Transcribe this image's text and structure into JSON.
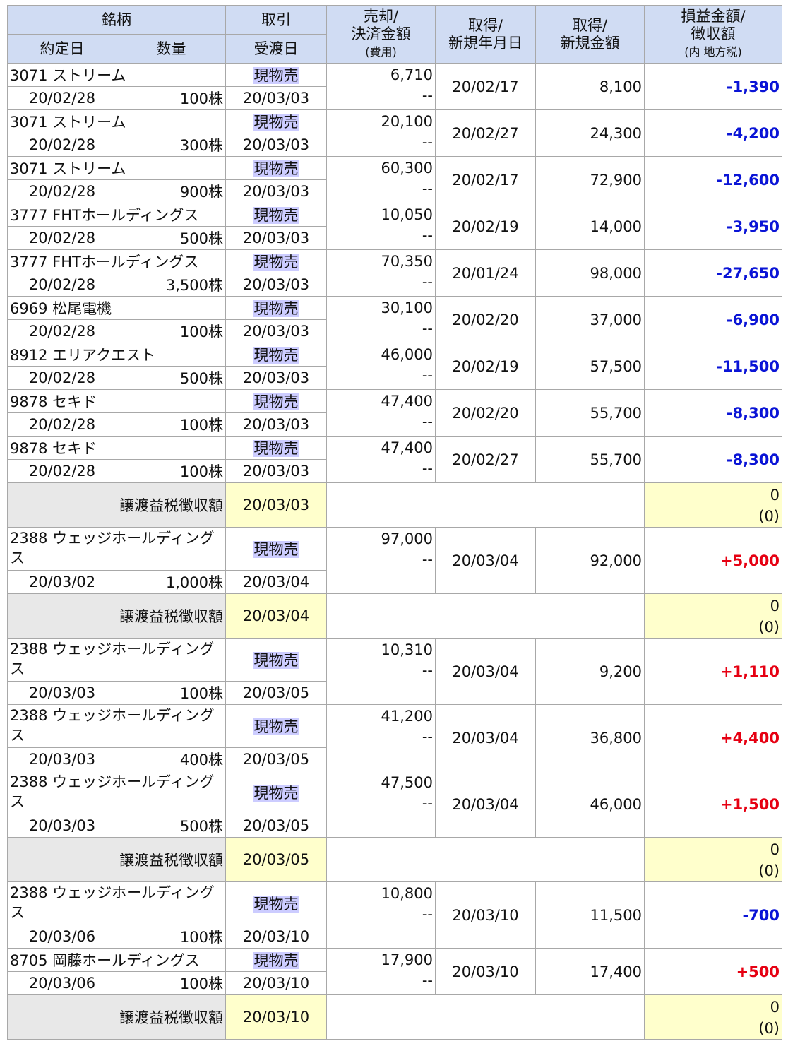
{
  "header": {
    "stock": "銘柄",
    "trade_date": "約定日",
    "quantity": "数量",
    "trade": "取引",
    "settle_date": "受渡日",
    "sale_amount_1": "売却/",
    "sale_amount_2": "決済金額",
    "sale_amount_3": "(費用)",
    "acq_date_1": "取得/",
    "acq_date_2": "新規年月日",
    "acq_amount_1": "取得/",
    "acq_amount_2": "新規金額",
    "pl_1": "損益金額/",
    "pl_2": "徴収額",
    "pl_3": "(内 地方税)"
  },
  "tax_label": "譲渡益税徴収額",
  "rows": [
    {
      "name": "3071 ストリーム",
      "trade_date": "20/02/28",
      "qty": "100株",
      "type": "現物売",
      "settle": "20/03/03",
      "sale": "6,710",
      "fee": "--",
      "acq_date": "20/02/17",
      "acq_amount": "8,100",
      "pl": "-1,390"
    },
    {
      "name": "3071 ストリーム",
      "trade_date": "20/02/28",
      "qty": "300株",
      "type": "現物売",
      "settle": "20/03/03",
      "sale": "20,100",
      "fee": "--",
      "acq_date": "20/02/27",
      "acq_amount": "24,300",
      "pl": "-4,200"
    },
    {
      "name": "3071 ストリーム",
      "trade_date": "20/02/28",
      "qty": "900株",
      "type": "現物売",
      "settle": "20/03/03",
      "sale": "60,300",
      "fee": "--",
      "acq_date": "20/02/17",
      "acq_amount": "72,900",
      "pl": "-12,600"
    },
    {
      "name": "3777 FHTホールディングス",
      "trade_date": "20/02/28",
      "qty": "500株",
      "type": "現物売",
      "settle": "20/03/03",
      "sale": "10,050",
      "fee": "--",
      "acq_date": "20/02/19",
      "acq_amount": "14,000",
      "pl": "-3,950"
    },
    {
      "name": "3777 FHTホールディングス",
      "trade_date": "20/02/28",
      "qty": "3,500株",
      "type": "現物売",
      "settle": "20/03/03",
      "sale": "70,350",
      "fee": "--",
      "acq_date": "20/01/24",
      "acq_amount": "98,000",
      "pl": "-27,650"
    },
    {
      "name": "6969 松尾電機",
      "trade_date": "20/02/28",
      "qty": "100株",
      "type": "現物売",
      "settle": "20/03/03",
      "sale": "30,100",
      "fee": "--",
      "acq_date": "20/02/20",
      "acq_amount": "37,000",
      "pl": "-6,900"
    },
    {
      "name": "8912 エリアクエスト",
      "trade_date": "20/02/28",
      "qty": "500株",
      "type": "現物売",
      "settle": "20/03/03",
      "sale": "46,000",
      "fee": "--",
      "acq_date": "20/02/19",
      "acq_amount": "57,500",
      "pl": "-11,500"
    },
    {
      "name": "9878 セキド",
      "trade_date": "20/02/28",
      "qty": "100株",
      "type": "現物売",
      "settle": "20/03/03",
      "sale": "47,400",
      "fee": "--",
      "acq_date": "20/02/20",
      "acq_amount": "55,700",
      "pl": "-8,300"
    },
    {
      "name": "9878 セキド",
      "trade_date": "20/02/28",
      "qty": "100株",
      "type": "現物売",
      "settle": "20/03/03",
      "sale": "47,400",
      "fee": "--",
      "acq_date": "20/02/27",
      "acq_amount": "55,700",
      "pl": "-8,300"
    },
    {
      "name": "2388 ウェッジホールディングス",
      "trade_date": "20/03/02",
      "qty": "1,000株",
      "type": "現物売",
      "settle": "20/03/04",
      "sale": "97,000",
      "fee": "--",
      "acq_date": "20/03/04",
      "acq_amount": "92,000",
      "pl": "+5,000"
    },
    {
      "name": "2388 ウェッジホールディングス",
      "trade_date": "20/03/03",
      "qty": "100株",
      "type": "現物売",
      "settle": "20/03/05",
      "sale": "10,310",
      "fee": "--",
      "acq_date": "20/03/04",
      "acq_amount": "9,200",
      "pl": "+1,110"
    },
    {
      "name": "2388 ウェッジホールディングス",
      "trade_date": "20/03/03",
      "qty": "400株",
      "type": "現物売",
      "settle": "20/03/05",
      "sale": "41,200",
      "fee": "--",
      "acq_date": "20/03/04",
      "acq_amount": "36,800",
      "pl": "+4,400"
    },
    {
      "name": "2388 ウェッジホールディングス",
      "trade_date": "20/03/03",
      "qty": "500株",
      "type": "現物売",
      "settle": "20/03/05",
      "sale": "47,500",
      "fee": "--",
      "acq_date": "20/03/04",
      "acq_amount": "46,000",
      "pl": "+1,500"
    },
    {
      "name": "2388 ウェッジホールディングス",
      "trade_date": "20/03/06",
      "qty": "100株",
      "type": "現物売",
      "settle": "20/03/10",
      "sale": "10,800",
      "fee": "--",
      "acq_date": "20/03/10",
      "acq_amount": "11,500",
      "pl": "-700"
    },
    {
      "name": "8705 岡藤ホールディングス",
      "trade_date": "20/03/06",
      "qty": "100株",
      "type": "現物売",
      "settle": "20/03/10",
      "sale": "17,900",
      "fee": "--",
      "acq_date": "20/03/10",
      "acq_amount": "17,400",
      "pl": "+500"
    }
  ],
  "tax_rows": [
    {
      "date": "20/03/03",
      "amount": "0",
      "local": "(0)"
    },
    {
      "date": "20/03/04",
      "amount": "0",
      "local": "(0)"
    },
    {
      "date": "20/03/05",
      "amount": "0",
      "local": "(0)"
    },
    {
      "date": "20/03/10",
      "amount": "0",
      "local": "(0)"
    }
  ],
  "colors": {
    "loss": "#0a14d6",
    "gain": "#e60012",
    "header_bg": "#d0dcf3",
    "tax_bg": "#e8e8e8",
    "tax_highlight": "#ffffcc",
    "trade_highlight": "#ccccff"
  }
}
